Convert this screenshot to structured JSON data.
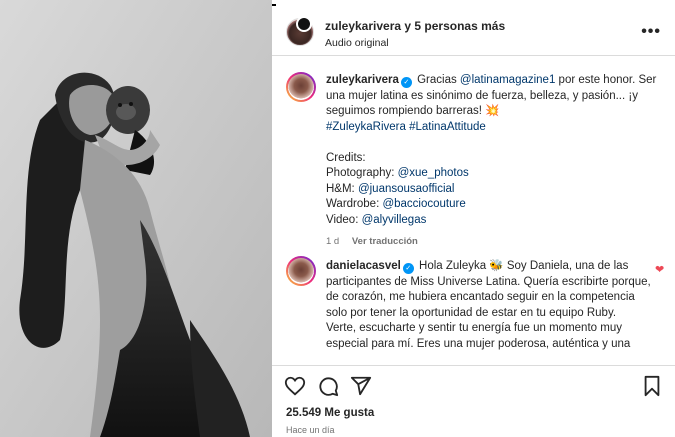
{
  "header": {
    "username": "zuleykarivera",
    "others": "y 5 personas más",
    "audio": "Audio original",
    "more_icon": "more-horizontal-icon",
    "more_label": "•••"
  },
  "caption": {
    "username": "zuleykarivera",
    "text_1": "Gracias ",
    "mention_1": "@latinamagazine1",
    "text_2": " por este honor. Ser una mujer latina es sinónimo de fuerza, belleza, y pasión... ¡y seguimos rompiendo barreras! ",
    "emoji": "💥",
    "hashtags": "#ZuleykaRivera #LatinaAttitude",
    "credits_title": "Credits:",
    "credits": [
      {
        "role": "Photography: ",
        "handle": "@xue_photos"
      },
      {
        "role": "H&M: ",
        "handle": "@juansousaofficial"
      },
      {
        "role": "Wardrobe: ",
        "handle": "@bacciocouture"
      },
      {
        "role": "Video: ",
        "handle": "@alyvillegas"
      }
    ],
    "time": "1 d",
    "translate": "Ver traducción"
  },
  "comment": {
    "username": "danielacasvel",
    "text_1": "Hola Zuleyka ",
    "emoji": "🐝",
    "body": "Soy Daniela, una de las participantes de Miss Universe Latina. Quería escribirte porque, de corazón, me hubiera encantado seguir en la competencia solo por tener la oportunidad de estar en tu equipo Ruby.",
    "body_2": "Verte, escucharte y sentir tu energía fue un momento muy especial para mí. Eres una mujer poderosa, auténtica y una",
    "liked_icon": "heart-filled-icon"
  },
  "footer": {
    "likes": "25.549 Me gusta",
    "time": "Hace un día",
    "icons": [
      "heart-icon",
      "comment-icon",
      "share-icon",
      "bookmark-icon"
    ]
  },
  "colors": {
    "link": "#00376b",
    "verified": "#0095f6",
    "muted": "#737373",
    "like": "#ed4956"
  }
}
